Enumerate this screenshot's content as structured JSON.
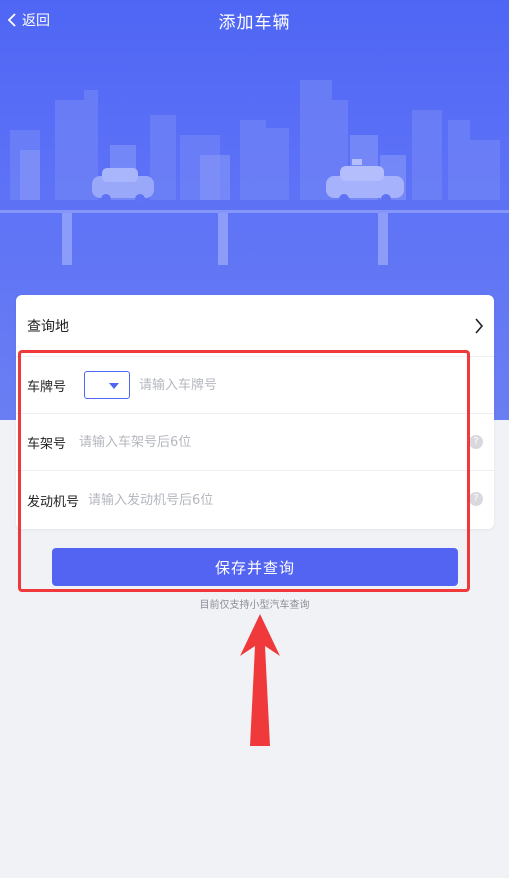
{
  "header": {
    "back_label": "返回",
    "title": "添加车辆"
  },
  "form": {
    "query_location_label": "查询地",
    "plate_label": "车牌号",
    "plate_placeholder": "请输入车牌号",
    "vin_label": "车架号",
    "vin_placeholder": "请输入车架号后6位",
    "engine_label": "发动机号",
    "engine_placeholder": "请输入发动机号后6位",
    "help_glyph": "?"
  },
  "submit_label": "保存并查询",
  "tip": "目前仅支持小型汽车查询",
  "colors": {
    "brand": "#5364f2",
    "hero": "#4f66f5",
    "annotation": "#f0393a"
  }
}
